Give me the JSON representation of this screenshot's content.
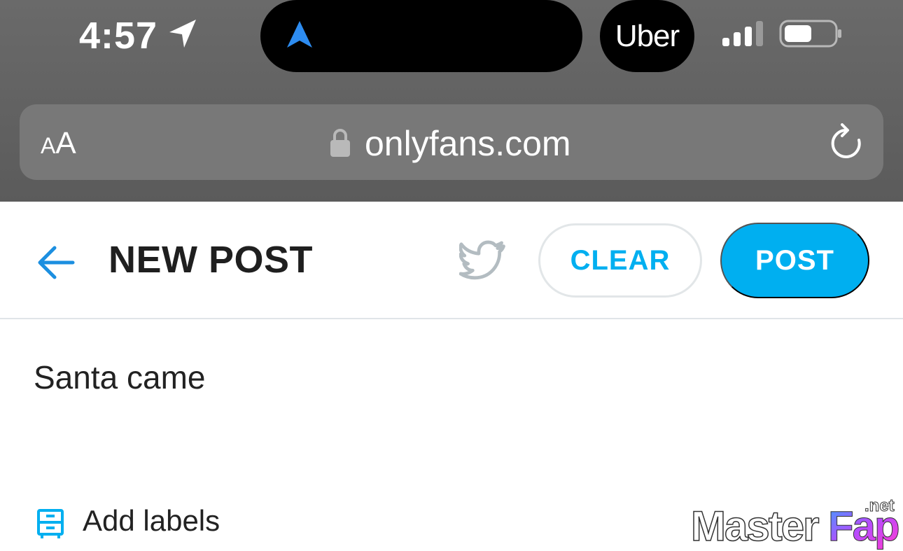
{
  "status_bar": {
    "time": "4:57",
    "live_activity": "Uber"
  },
  "browser": {
    "text_size_button": {
      "small": "A",
      "large": "A"
    },
    "url": "onlyfans.com"
  },
  "header": {
    "title": "NEW POST",
    "clear_label": "CLEAR",
    "post_label": "POST"
  },
  "composer": {
    "text": "Santa came"
  },
  "labels": {
    "add_label": "Add labels"
  },
  "watermark": {
    "main": "MasterFap",
    "suffix": ".net"
  },
  "icons": {
    "location": "location-arrow-icon",
    "navigation": "navigation-arrow-icon",
    "signal": "cellular-signal-icon",
    "battery": "battery-icon",
    "lock": "lock-icon",
    "reload": "reload-icon",
    "back": "back-arrow-icon",
    "twitter": "twitter-icon",
    "labels": "labels-icon"
  },
  "colors": {
    "accent": "#00aff0",
    "back_arrow": "#1c8fe0",
    "chrome_bg": "#626262",
    "url_bar_bg": "#787878"
  }
}
